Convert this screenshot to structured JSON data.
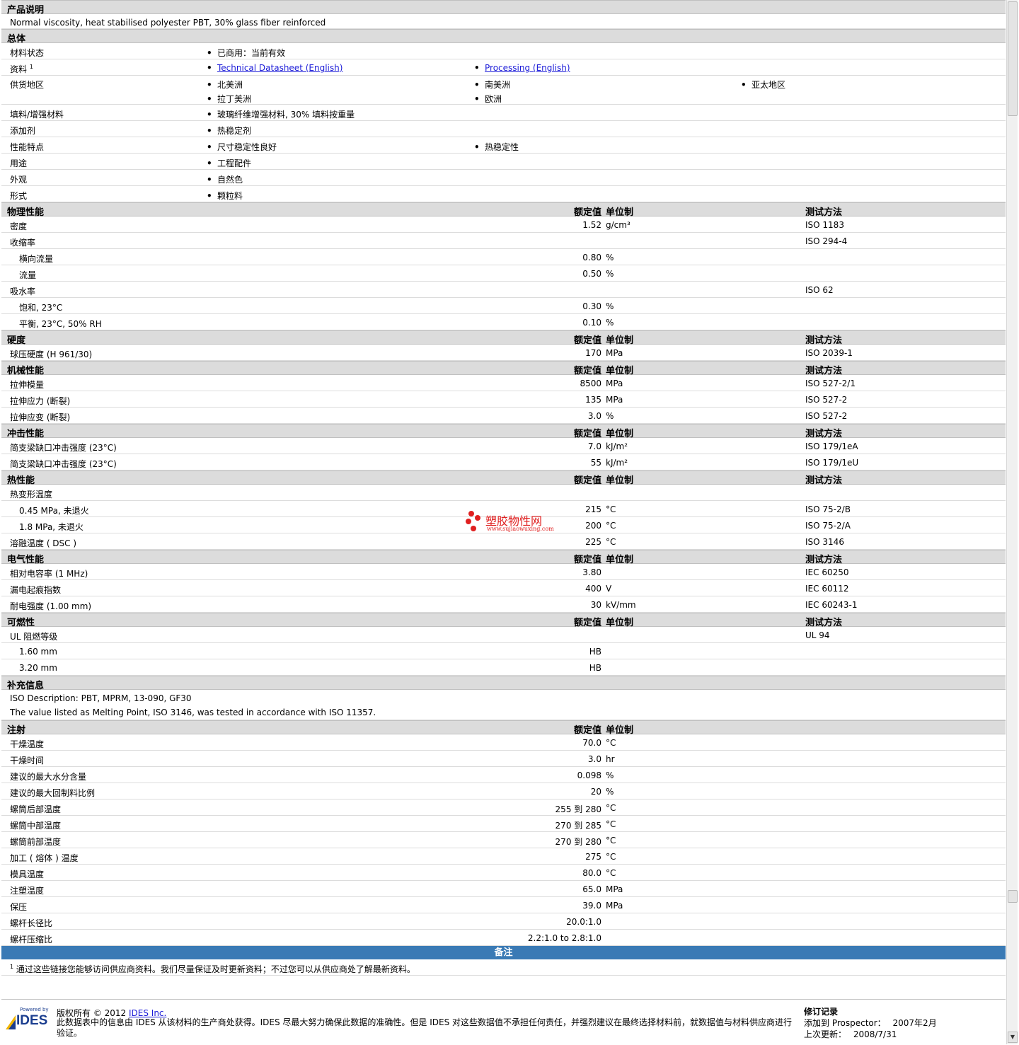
{
  "product_desc": {
    "title": "产品说明",
    "text": "Normal viscosity, heat stabilised polyester PBT, 30% glass fiber reinforced"
  },
  "general": {
    "title": "总体",
    "material_status_label": "材料状态",
    "material_status": "已商用：当前有效",
    "docs_label": "资料",
    "docs_sup": "1",
    "doc1": "Technical Datasheet (English)",
    "doc2": "Processing (English)",
    "supply_label": "供货地区",
    "supply": [
      "北美洲",
      "南美洲",
      "亚太地区",
      "拉丁美洲",
      "欧洲"
    ],
    "filler_label": "填料/增强材料",
    "filler": "玻璃纤维增强材料, 30% 填料按重量",
    "additive_label": "添加剂",
    "additive": "热稳定剂",
    "features_label": "性能特点",
    "features": [
      "尺寸稳定性良好",
      "热稳定性"
    ],
    "uses_label": "用途",
    "uses": "工程配件",
    "appearance_label": "外观",
    "appearance": "自然色",
    "form_label": "形式",
    "form": "颗粒料"
  },
  "headers": {
    "value": "额定值",
    "unit": "单位制",
    "method": "测试方法"
  },
  "physical": {
    "title": "物理性能",
    "rows": [
      {
        "label": "密度",
        "value": "1.52",
        "unit": "g/cm³",
        "method": "ISO 1183"
      },
      {
        "label": "收缩率",
        "value": "",
        "unit": "",
        "method": "ISO 294-4"
      },
      {
        "label": "横向流量",
        "value": "0.80",
        "unit": "%",
        "method": ""
      },
      {
        "label": "流量",
        "value": "0.50",
        "unit": "%",
        "method": ""
      },
      {
        "label": "吸水率",
        "value": "",
        "unit": "",
        "method": "ISO 62"
      },
      {
        "label": "饱和, 23°C",
        "value": "0.30",
        "unit": "%",
        "method": ""
      },
      {
        "label": "平衡, 23°C, 50% RH",
        "value": "0.10",
        "unit": "%",
        "method": ""
      }
    ]
  },
  "hardness": {
    "title": "硬度",
    "rows": [
      {
        "label": "球压硬度 (H 961/30)",
        "value": "170",
        "unit": "MPa",
        "method": "ISO 2039-1"
      }
    ]
  },
  "mechanical": {
    "title": "机械性能",
    "rows": [
      {
        "label": "拉伸模量",
        "value": "8500",
        "unit": "MPa",
        "method": "ISO 527-2/1"
      },
      {
        "label": "拉伸应力 (断裂)",
        "value": "135",
        "unit": "MPa",
        "method": "ISO 527-2"
      },
      {
        "label": "拉伸应变 (断裂)",
        "value": "3.0",
        "unit": "%",
        "method": "ISO 527-2"
      }
    ]
  },
  "impact": {
    "title": "冲击性能",
    "rows": [
      {
        "label": "简支梁缺口冲击强度 (23°C)",
        "value": "7.0",
        "unit": "kJ/m²",
        "method": "ISO 179/1eA"
      },
      {
        "label": "简支梁缺口冲击强度 (23°C)",
        "value": "55",
        "unit": "kJ/m²",
        "method": "ISO 179/1eU"
      }
    ]
  },
  "thermal": {
    "title": "热性能",
    "rows": [
      {
        "label": "热变形温度",
        "value": "",
        "unit": "",
        "method": ""
      },
      {
        "label": "0.45 MPa, 未退火",
        "value": "215",
        "unit": "°C",
        "method": "ISO 75-2/B"
      },
      {
        "label": "1.8 MPa, 未退火",
        "value": "200",
        "unit": "°C",
        "method": "ISO 75-2/A"
      },
      {
        "label": "溶融温度 ( DSC )",
        "value": "225",
        "unit": "°C",
        "method": "ISO 3146"
      }
    ]
  },
  "electrical": {
    "title": "电气性能",
    "rows": [
      {
        "label": "相对电容率 (1 MHz)",
        "value": "3.80",
        "unit": "",
        "method": "IEC 60250"
      },
      {
        "label": "漏电起痕指数",
        "value": "400",
        "unit": "V",
        "method": "IEC 60112"
      },
      {
        "label": "耐电强度 (1.00 mm)",
        "value": "30",
        "unit": "kV/mm",
        "method": "IEC 60243-1"
      }
    ]
  },
  "flammability": {
    "title": "可燃性",
    "rows": [
      {
        "label": "UL 阻燃等级",
        "value": "",
        "unit": "",
        "method": "UL 94"
      },
      {
        "label": "1.60 mm",
        "value": "HB",
        "unit": "",
        "method": ""
      },
      {
        "label": "3.20 mm",
        "value": "HB",
        "unit": "",
        "method": ""
      }
    ]
  },
  "supplementary": {
    "title": "补充信息",
    "line1": "ISO Description: PBT, MPRM, 13-090, GF30",
    "line2": "The value listed as Melting Point, ISO 3146, was tested in accordance with ISO 11357."
  },
  "injection": {
    "title": "注射",
    "rows": [
      {
        "label": "干燥温度",
        "value": "70.0",
        "unit": "°C"
      },
      {
        "label": "干燥时间",
        "value": "3.0",
        "unit": "hr"
      },
      {
        "label": "建议的最大水分含量",
        "value": "0.098",
        "unit": "%"
      },
      {
        "label": "建议的最大回制料比例",
        "value": "20",
        "unit": "%"
      },
      {
        "label": "螺筒后部温度",
        "value": "255 到  280",
        "unit": "°C"
      },
      {
        "label": "螺筒中部温度",
        "value": "270 到  285",
        "unit": "°C"
      },
      {
        "label": "螺筒前部温度",
        "value": "270 到  280",
        "unit": "°C"
      },
      {
        "label": "加工 ( 熔体 ) 温度",
        "value": "275",
        "unit": "°C"
      },
      {
        "label": "模具温度",
        "value": "80.0",
        "unit": "°C"
      },
      {
        "label": "注塑温度",
        "value": "65.0",
        "unit": "MPa"
      },
      {
        "label": "保压",
        "value": "39.0",
        "unit": "MPa"
      },
      {
        "label": "螺杆长径比",
        "value": "20.0:1.0",
        "unit": ""
      },
      {
        "label": "螺杆压缩比",
        "value": "2.2:1.0 to 2.8:1.0",
        "unit": ""
      }
    ]
  },
  "notes": {
    "title": "备注",
    "sup": "1",
    "text": "通过这些链接您能够访问供应商资料。我们尽量保证及时更新资料；不过您可以从供应商处了解最新资料。"
  },
  "watermark": {
    "name": "塑胶物性网",
    "url": "www.sujiaowuxing.com"
  },
  "footer": {
    "logo_small": "Powered by",
    "logo_text": "IDES",
    "copyright_prefix": "版权所有 © 2012 ",
    "company_link": "IDES Inc.",
    "disclaimer": "此数据表中的信息由 IDES 从该材料的生产商处获得。IDES 尽最大努力确保此数据的准确性。但是 IDES 对这些数据值不承担任何责任，并强烈建议在最终选择材料前，就数据值与材料供应商进行验证。",
    "revision_title": "修订记录",
    "added_label": "添加到 Prospector：",
    "added_date": "2007年2月",
    "updated_label": "上次更新：",
    "updated_date": "2008/7/31"
  },
  "colors": {
    "section_bg": "#dcdcdc",
    "notes_bar": "#3a7ab5",
    "link": "#1b1bd8",
    "logo_blue": "#1a3d8f",
    "watermark_red": "#e02020"
  }
}
